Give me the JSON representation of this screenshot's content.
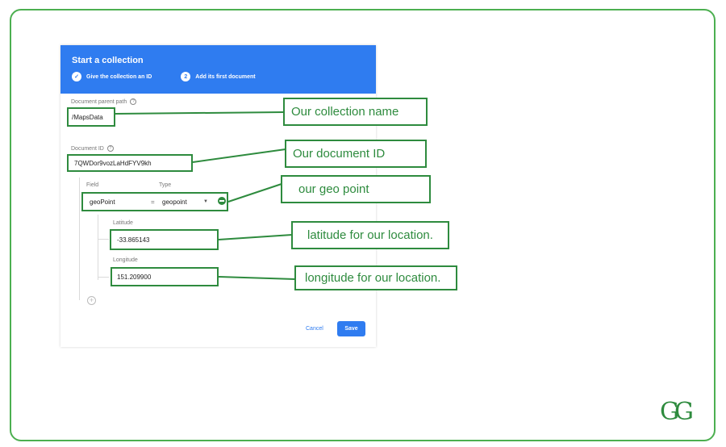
{
  "dialog": {
    "title": "Start a collection",
    "steps": [
      {
        "label": "Give the collection an ID",
        "marker": "✓",
        "done": true
      },
      {
        "label": "Add its first document",
        "marker": "2",
        "done": false
      }
    ],
    "parent_path_label": "Document parent path",
    "parent_path_value": "/MapsData",
    "doc_id_label": "Document ID",
    "doc_id_value": "7QWDor9vozLaHdFYV9kh",
    "field_header": "Field",
    "type_header": "Type",
    "field_name": "geoPoint",
    "equals": "=",
    "type_value": "geopoint",
    "latitude_label": "Latitude",
    "latitude_value": "-33.865143",
    "longitude_label": "Longitude",
    "longitude_value": "151.209900",
    "cancel_label": "Cancel",
    "save_label": "Save"
  },
  "callouts": {
    "collection": "Our collection name",
    "document": "Our document ID",
    "geo": "our geo point",
    "latitude": "latitude for our location.",
    "longitude": "longitude for our location."
  },
  "logo_text": "GG",
  "colors": {
    "accent": "#2e8b3e",
    "primary": "#2f7cf0"
  }
}
